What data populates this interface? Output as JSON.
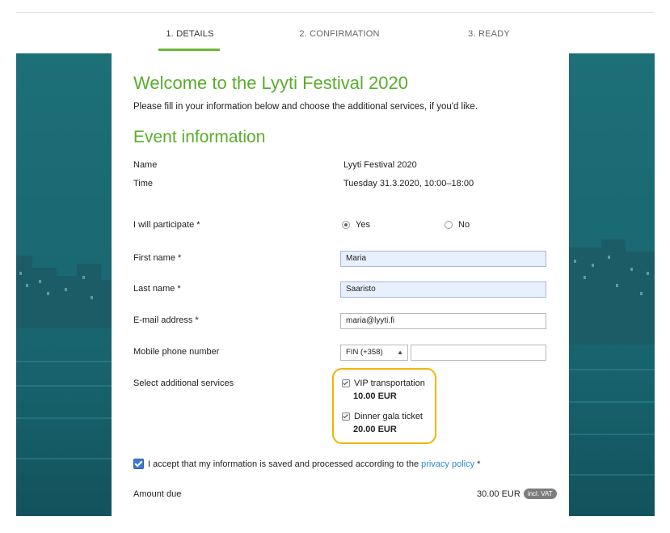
{
  "steps": [
    {
      "label": "1. DETAILS",
      "active": true
    },
    {
      "label": "2. CONFIRMATION",
      "active": false
    },
    {
      "label": "3. READY",
      "active": false
    }
  ],
  "header": {
    "title": "Welcome to the Lyyti Festival 2020",
    "intro": "Please fill in your information below and choose the additional services, if you'd like."
  },
  "event": {
    "heading": "Event information",
    "name_label": "Name",
    "name_value": "Lyyti Festival 2020",
    "time_label": "Time",
    "time_value": "Tuesday 31.3.2020, 10:00–18:00"
  },
  "form": {
    "participate_label": "I will participate *",
    "participate_yes": "Yes",
    "participate_no": "No",
    "participate_selected": "Yes",
    "first_name_label": "First name *",
    "first_name_value": "Maria",
    "last_name_label": "Last name *",
    "last_name_value": "Saaristo",
    "email_label": "E-mail address *",
    "email_value": "maria@lyyti.fi",
    "phone_label": "Mobile phone number",
    "phone_country": "FIN (+358)",
    "phone_value": "",
    "services_label": "Select additional services",
    "services": [
      {
        "name": "VIP transportation",
        "price": "10.00 EUR",
        "checked": true
      },
      {
        "name": "Dinner gala ticket",
        "price": "20.00 EUR",
        "checked": true
      }
    ],
    "consent_text": "I accept that my information is saved and processed according to the",
    "consent_link": "privacy policy",
    "consent_suffix": "*",
    "consent_checked": true
  },
  "total": {
    "label": "Amount due",
    "value": "30.00 EUR",
    "badge": "incl. VAT"
  },
  "colors": {
    "accent_green": "#5aad2c",
    "highlight": "#f0b400",
    "link": "#2d8bd0"
  }
}
